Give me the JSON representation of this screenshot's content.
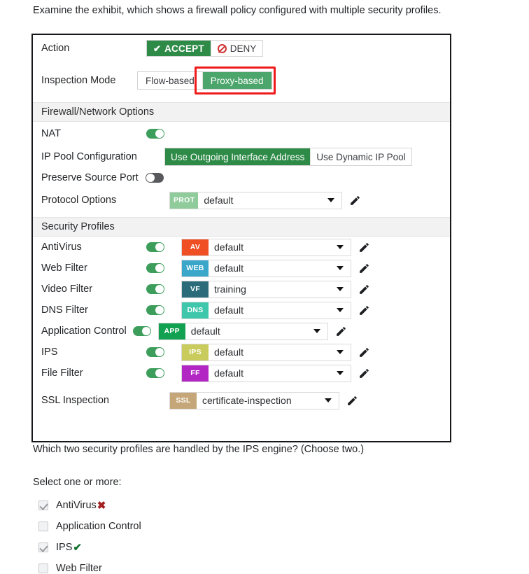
{
  "intro": "Examine the exhibit, which shows a firewall policy configured with multiple security profiles.",
  "exhibit": {
    "action": {
      "label": "Action",
      "options": [
        {
          "label": "ACCEPT",
          "icon": "check-icon",
          "selected": true
        },
        {
          "label": "DENY",
          "icon": "deny-circle-icon",
          "selected": false
        }
      ]
    },
    "inspection_mode": {
      "label": "Inspection Mode",
      "options": [
        {
          "label": "Flow-based",
          "selected": false
        },
        {
          "label": "Proxy-based",
          "selected": true,
          "highlighted": true
        }
      ],
      "highlight_color": "#f01a1a"
    },
    "firewall_section": {
      "title": "Firewall/Network Options",
      "nat": {
        "label": "NAT",
        "state": "on"
      },
      "ip_pool": {
        "label": "IP Pool Configuration",
        "options": [
          {
            "label": "Use Outgoing Interface Address",
            "selected": true
          },
          {
            "label": "Use Dynamic IP Pool",
            "selected": false
          }
        ]
      },
      "preserve_source_port": {
        "label": "Preserve Source Port",
        "state": "off"
      },
      "protocol_options": {
        "label": "Protocol Options",
        "badge": "PROT",
        "badge_color": "#8fcb9b",
        "value": "default",
        "edit_icon": "pencil-icon",
        "caret_icon": "chevron-down-icon"
      }
    },
    "security_section": {
      "title": "Security Profiles",
      "profiles": [
        {
          "label": "AntiVirus",
          "toggle": "on",
          "badge": "AV",
          "badge_color": "#f04e23",
          "value": "default"
        },
        {
          "label": "Web Filter",
          "toggle": "on",
          "badge": "WEB",
          "badge_color": "#3aa6ca",
          "value": "default"
        },
        {
          "label": "Video Filter",
          "toggle": "on",
          "badge": "VF",
          "badge_color": "#2c6b7a",
          "value": "training"
        },
        {
          "label": "DNS Filter",
          "toggle": "on",
          "badge": "DNS",
          "badge_color": "#3ec7ab",
          "value": "default"
        },
        {
          "label": "Application Control",
          "toggle": "on",
          "badge": "APP",
          "badge_color": "#12a150",
          "value": "default"
        },
        {
          "label": "IPS",
          "toggle": "on",
          "badge": "IPS",
          "badge_color": "#c9cc5c",
          "value": "default"
        },
        {
          "label": "File Filter",
          "toggle": "on",
          "badge": "FF",
          "badge_color": "#b226c4",
          "value": "default"
        }
      ],
      "ssl_inspection": {
        "label": "SSL Inspection",
        "badge": "SSL",
        "badge_color": "#c5a678",
        "value": "certificate-inspection"
      }
    }
  },
  "question": "Which two security profiles are handled by the IPS engine? (Choose two.)",
  "select_prompt": "Select one or more:",
  "answers": [
    {
      "label": "AntiVirus",
      "checked": true,
      "mark": "✖",
      "mark_type": "wrong"
    },
    {
      "label": "Application Control",
      "checked": false,
      "mark": "",
      "mark_type": "none"
    },
    {
      "label": "IPS",
      "checked": true,
      "mark": "✔",
      "mark_type": "right"
    },
    {
      "label": "Web Filter",
      "checked": false,
      "mark": "",
      "mark_type": "none"
    }
  ]
}
